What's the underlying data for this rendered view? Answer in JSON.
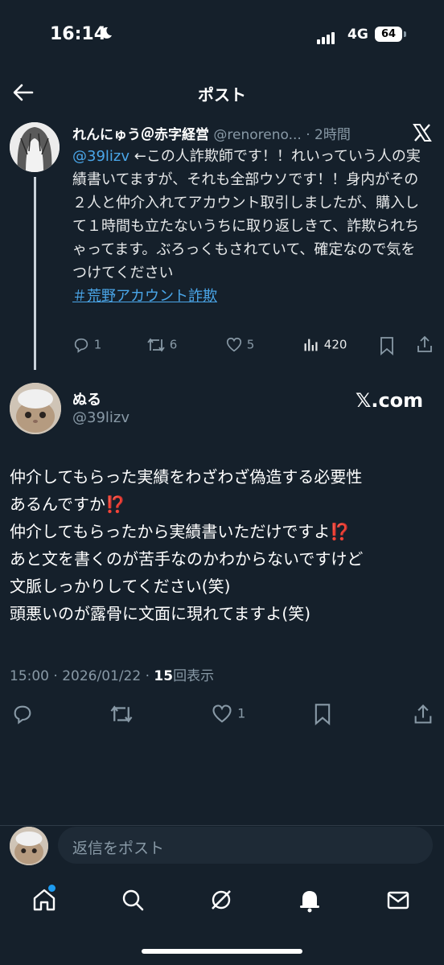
{
  "status_bar": {
    "time": "16:14",
    "network": "4G",
    "battery": "64"
  },
  "header": {
    "title": "ポスト"
  },
  "quoted_post": {
    "name": "れんにゅう＠赤字経営",
    "handle": "@renoreno...",
    "separator": "·",
    "time": "2時間",
    "mention": "@39lizv",
    "text": " ←この人詐欺師です！！れいっていう人の実績書いてますが、それも全部ウソです！！身内がその２人と仲介入れてアカウント取引しましたが、購入して１時間も立たないうちに取り返しきて、詐欺られちゃってます。ぶろっくもされていて、確定なので気をつけてください",
    "hashtag": "＃荒野アカウント詐欺",
    "replies": "1",
    "retweets": "6",
    "likes": "5",
    "views": "420"
  },
  "post": {
    "name": "ぬる",
    "handle": "@39lizv",
    "source": "𝕏.com",
    "lines": [
      "仲介してもらった実績をわざわざ偽造する必要性",
      "あるんですか⁉️",
      "仲介してもらったから実績書いただけですよ⁉️",
      "あと文を書くのが苦手なのかわからないですけど",
      "文脈しっかりしてください(笑)",
      "頭悪いのが露骨に文面に現れてますよ(笑)"
    ],
    "timestamp": "15:00 · 2026/01/22 · ",
    "views_count": "15",
    "views_label": "回表示",
    "likes": "1"
  },
  "reply": {
    "placeholder": "返信をポスト"
  },
  "colors": {
    "background": "#15202b",
    "link": "#4aa6e9",
    "muted": "#8899a6",
    "accent": "#1d9bf0"
  },
  "icons": [
    "back-arrow-icon",
    "x-logo-icon",
    "reply-icon",
    "retweet-icon",
    "like-icon",
    "views-icon",
    "bookmark-icon",
    "share-icon",
    "home-icon",
    "search-icon",
    "grok-icon",
    "notifications-icon",
    "messages-icon"
  ]
}
